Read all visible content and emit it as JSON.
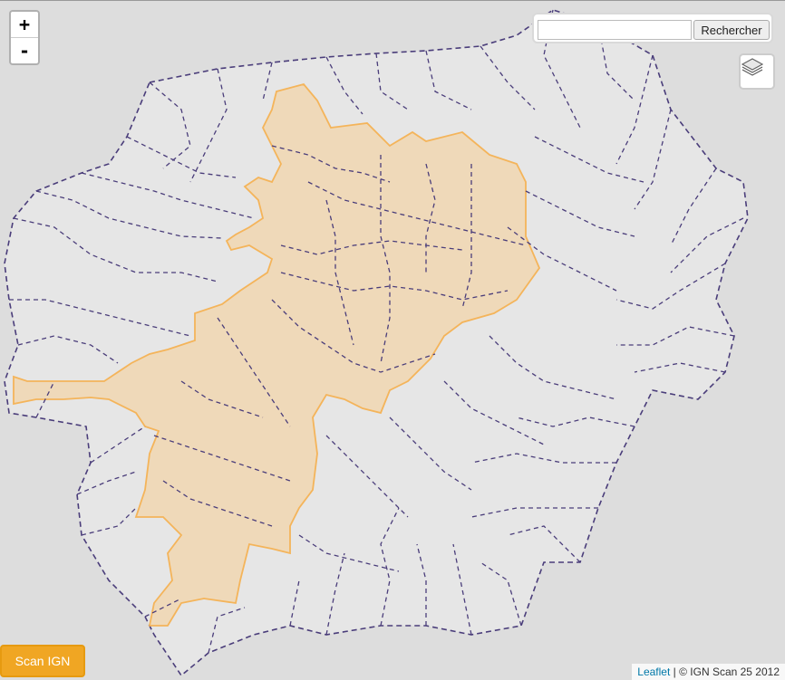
{
  "map": {
    "zoom_in_label": "+",
    "zoom_out_label": "-"
  },
  "search": {
    "input_value": "",
    "button_label": "Rechercher"
  },
  "layers": {
    "icon": "layers-icon"
  },
  "scan_button_label": "Scan IGN",
  "attribution": {
    "link_text": "Leaflet",
    "separator": " | ",
    "text": "© IGN Scan 25 2012"
  },
  "colors": {
    "background": "#dddddd",
    "highlight_fill": "#f0d6b0",
    "highlight_stroke": "#f4b45a",
    "border_dashed": "#4a3d7a",
    "accent_button": "#f0a623"
  }
}
